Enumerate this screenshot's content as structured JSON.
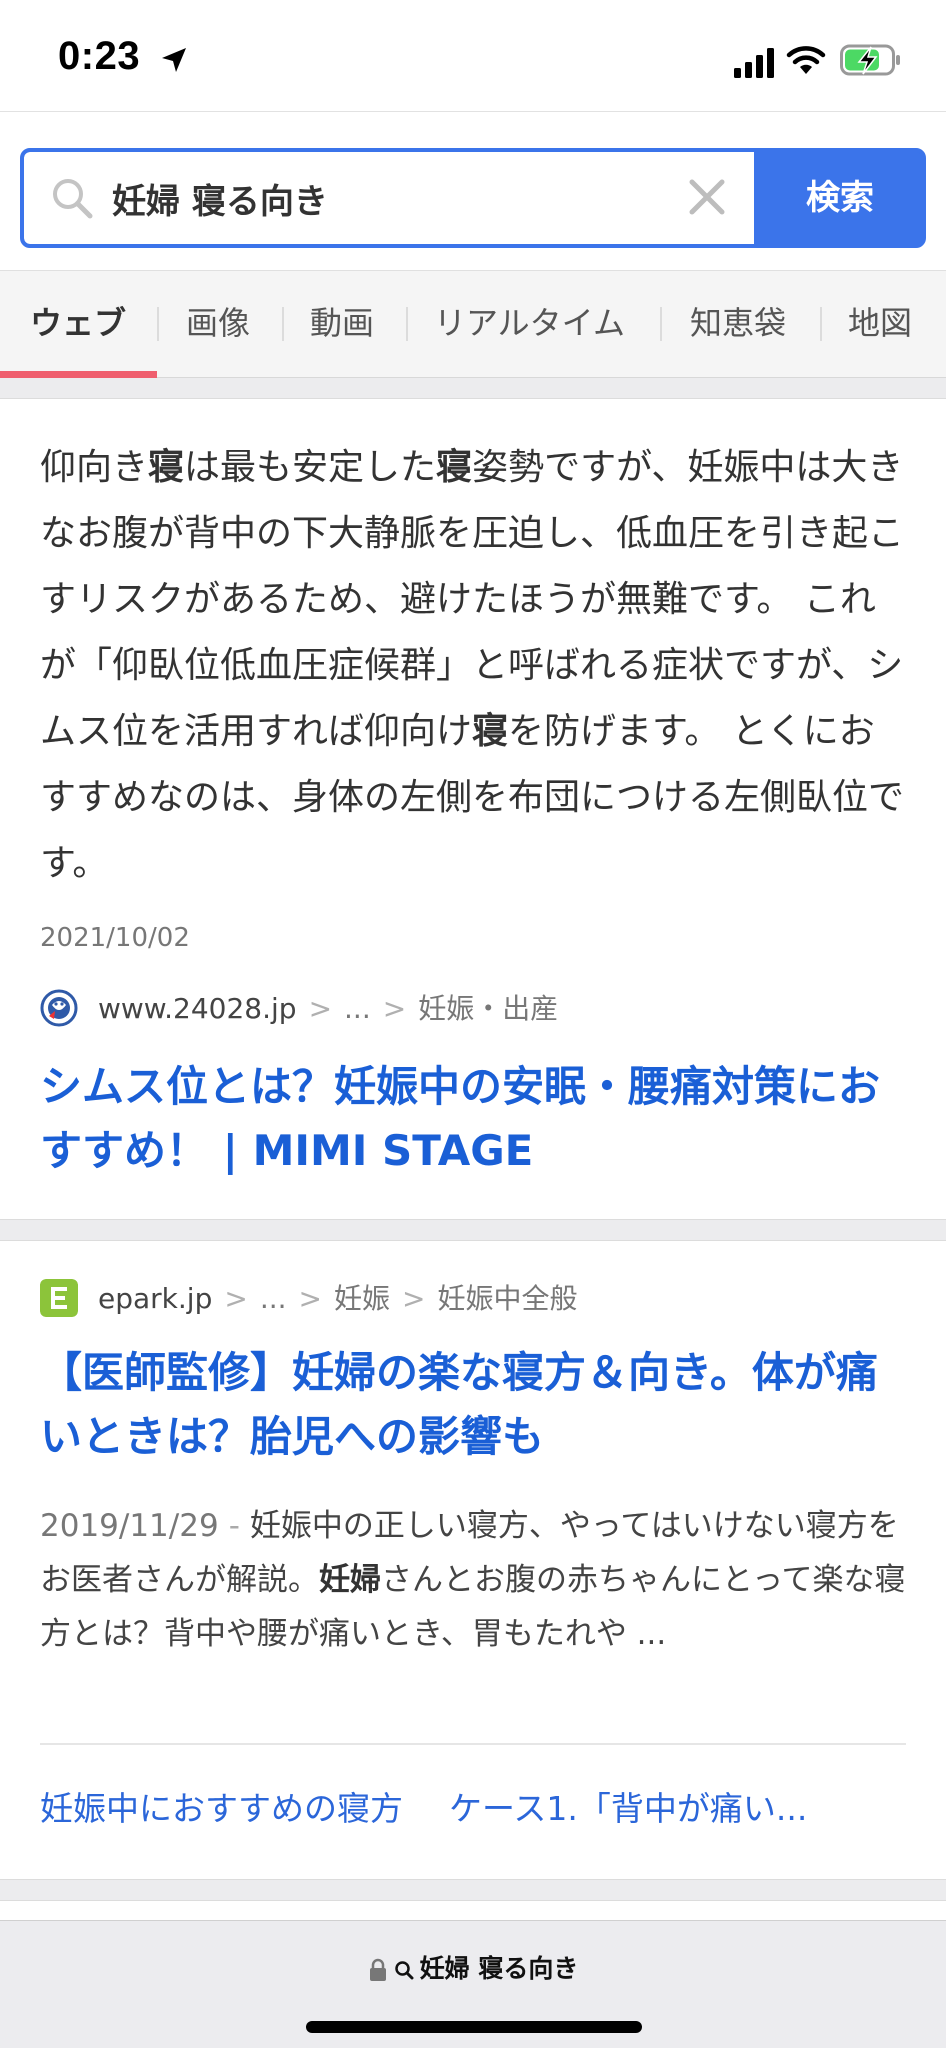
{
  "status_bar": {
    "time": "0:23"
  },
  "search": {
    "query": "妊婦 寝る向き",
    "button_label": "検索"
  },
  "tabs": [
    "ウェブ",
    "画像",
    "動画",
    "リアルタイム",
    "知恵袋",
    "地図"
  ],
  "results": [
    {
      "snippet_parts": [
        {
          "t": "仰向き",
          "b": false
        },
        {
          "t": "寝",
          "b": true
        },
        {
          "t": "は最も安定した",
          "b": false
        },
        {
          "t": "寝",
          "b": true
        },
        {
          "t": "姿勢ですが、妊娠中は大きなお腹が背中の下大静脈を圧迫し、低血圧を引き起こすリスクがあるため、避けたほうが無難です。 これが「仰臥位低血圧症候群」と呼ばれる症状ですが、シムス位を活用すれば仰向け",
          "b": false
        },
        {
          "t": "寝",
          "b": true
        },
        {
          "t": "を防げます。 とくにおすすめなのは、身体の左側を布団につける左側臥位です。",
          "b": false
        }
      ],
      "date": "2021/10/02",
      "domain": "www.24028.jp",
      "crumbs": [
        "...",
        "妊娠・出産"
      ],
      "title": "シムス位とは？妊娠中の安眠・腰痛対策におすすめ！ | MIMI STAGE"
    },
    {
      "domain": "epark.jp",
      "favicon_letter": "E",
      "crumbs": [
        "...",
        "妊娠",
        "妊娠中全般"
      ],
      "title": "【医師監修】妊婦の楽な寝方＆向き。体が痛いときは？胎児への影響も",
      "date": "2019/11/29",
      "snippet_parts": [
        {
          "t": "妊娠中の正しい寝方、やってはいけない寝方をお医者さんが解説。",
          "b": false
        },
        {
          "t": "妊婦",
          "b": true
        },
        {
          "t": "さんとお腹の赤ちゃんにとって楽な寝方とは？背中や腰が痛いとき、胃もたれや ...",
          "b": false
        }
      ],
      "sublinks": [
        "妊娠中におすすめの寝方",
        "ケース1.「背中が痛い..."
      ]
    }
  ],
  "bottom_bar": {
    "url": "妊婦 寝る向き"
  },
  "colors": {
    "accent_blue": "#3b74ea",
    "link_blue": "#1a5fd6",
    "tab_underline": "#ef5e6e",
    "battery_green": "#4cd964"
  }
}
